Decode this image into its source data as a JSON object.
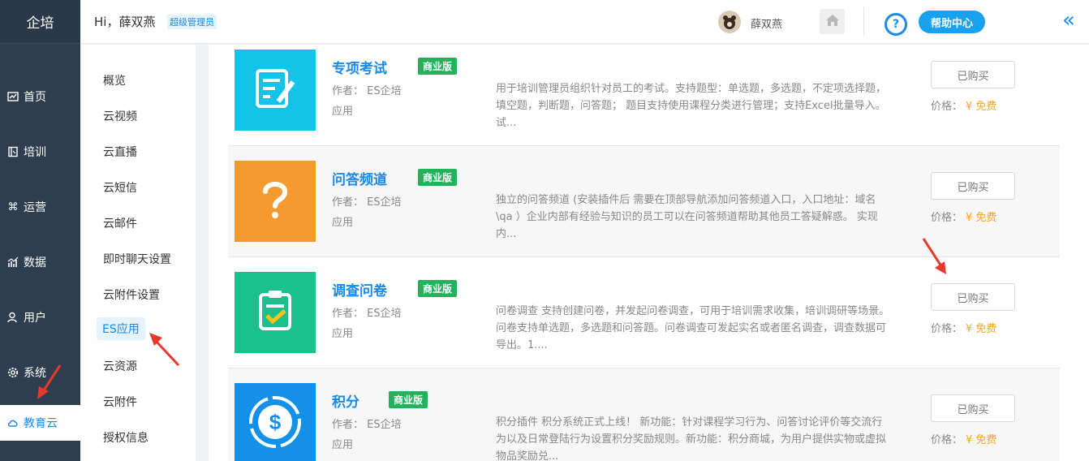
{
  "app": {
    "brand": "企培"
  },
  "nav": [
    {
      "label": "首页",
      "icon": "dashboard-icon"
    },
    {
      "label": "培训",
      "icon": "book-icon"
    },
    {
      "label": "运营",
      "icon": "command-icon"
    },
    {
      "label": "数据",
      "icon": "chart-icon"
    },
    {
      "label": "用户",
      "icon": "user-icon"
    },
    {
      "label": "系统",
      "icon": "gear-icon"
    },
    {
      "label": "教育云",
      "icon": "cloud-icon",
      "active": true
    }
  ],
  "header": {
    "greeting": "Hi，薛双燕",
    "role": "超级管理员",
    "username": "薛双燕",
    "help_label": "帮助中心",
    "help_symbol": "?",
    "collapse_symbol": "«"
  },
  "subnav": [
    {
      "label": "概览"
    },
    {
      "label": "云视频"
    },
    {
      "label": "云直播"
    },
    {
      "label": "云短信"
    },
    {
      "label": "云邮件"
    },
    {
      "label": "即时聊天设置"
    },
    {
      "label": "云附件设置"
    },
    {
      "label": "ES应用",
      "active": true
    },
    {
      "label": "云资源"
    },
    {
      "label": "云附件"
    },
    {
      "label": "授权信息"
    }
  ],
  "plugins": [
    {
      "name": "专项考试",
      "tag": "商业版",
      "author": "作者：  ES企培",
      "type": "应用",
      "desc": "用于培训管理员组织针对员工的考试。支持题型：单选题，多选题，不定项选择题，填空题，判断题，问答题； 题目支持使用课程分类进行管理；支持Excel批量导入。 试...",
      "button": "已购买",
      "price_label": "价格：",
      "price_value": "¥ 免费",
      "color": "#14c4e8",
      "icon": "exam-icon"
    },
    {
      "name": "问答频道",
      "tag": "商业版",
      "author": "作者：  ES企培",
      "type": "应用",
      "desc": "独立的问答频道 (安装插件后 需要在顶部导航添加问答频道入口，入口地址：域名\\qa ）企业内部有经验与知识的员工可以在问答频道帮助其他员工答疑解惑。 实现内...",
      "button": "已购买",
      "price_label": "价格：",
      "price_value": "¥ 免费",
      "color": "#f59a2e",
      "icon": "question-icon"
    },
    {
      "name": "调查问卷",
      "tag": "商业版",
      "author": "作者：  ES企培",
      "type": "应用",
      "desc": "问卷调查 支持创建问卷，并发起问卷调查，可用于培训需求收集，培训调研等场景。问卷支持单选题，多选题和问答题。问卷调查可发起实名或者匿名调查，调查数据可导出。1....",
      "button": "已购买",
      "price_label": "价格：",
      "price_value": "¥ 免费",
      "color": "#1bc08d",
      "icon": "survey-icon"
    },
    {
      "name": "积分",
      "tag": "商业版",
      "author": "作者：  ES企培",
      "type": "应用",
      "desc": "积分插件 积分系统正式上线！ 新功能：针对课程学习行为、问答讨论评价等交流行为以及日常登陆行为设置积分奖励规则。新功能：积分商城，为用户提供实物或虚拟物品奖励兑...",
      "button": "已购买",
      "price_label": "价格：",
      "price_value": "¥ 免费",
      "color": "#1490e8",
      "icon": "coin-icon"
    }
  ]
}
